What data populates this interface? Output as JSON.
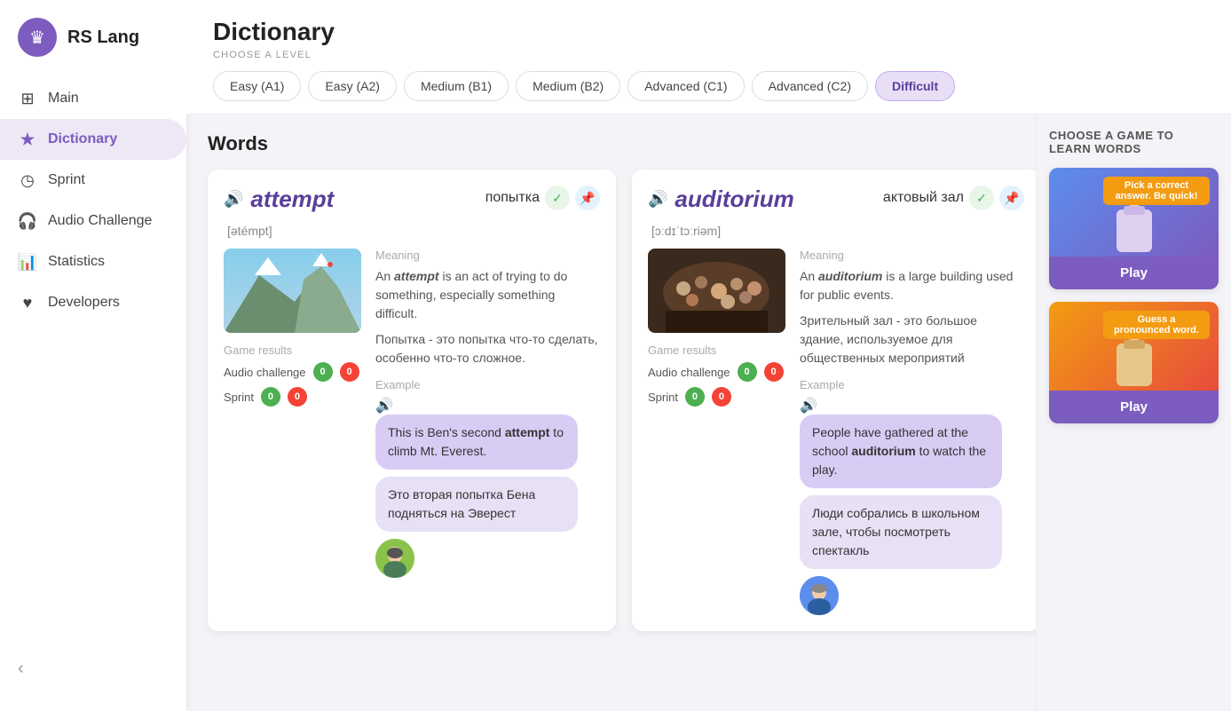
{
  "app": {
    "name": "RS Lang",
    "logo_symbol": "♛"
  },
  "sidebar": {
    "items": [
      {
        "id": "main",
        "label": "Main",
        "icon": "⊞"
      },
      {
        "id": "dictionary",
        "label": "Dictionary",
        "icon": "★",
        "active": true
      },
      {
        "id": "sprint",
        "label": "Sprint",
        "icon": "◷"
      },
      {
        "id": "audio-challenge",
        "label": "Audio Challenge",
        "icon": "🎧"
      },
      {
        "id": "statistics",
        "label": "Statistics",
        "icon": "📊"
      },
      {
        "id": "developers",
        "label": "Developers",
        "icon": "♥"
      }
    ],
    "collapse_label": "‹"
  },
  "header": {
    "title": "Dictionary",
    "level_label": "CHOOSE A LEVEL",
    "levels": [
      {
        "id": "a1",
        "label": "Easy (A1)"
      },
      {
        "id": "a2",
        "label": "Easy (A2)"
      },
      {
        "id": "b1",
        "label": "Medium (B1)"
      },
      {
        "id": "b2",
        "label": "Medium (B2)"
      },
      {
        "id": "c1",
        "label": "Advanced (C1)"
      },
      {
        "id": "c2",
        "label": "Advanced (C2)"
      },
      {
        "id": "difficult",
        "label": "Difficult",
        "active": true
      }
    ]
  },
  "words_section": {
    "title": "Words",
    "cards": [
      {
        "id": "attempt",
        "word": "attempt",
        "transcription": "[ətémpt]",
        "translation": "попытка",
        "meaning_en": "An attempt is an act of trying to do something, especially something difficult.",
        "meaning_ru": "Попытка - это попытка что-то сделать, особенно что-то сложное.",
        "example_en": "This is Ben's second attempt to climb Mt. Everest.",
        "example_ru": "Это вторая попытка Бена подняться на Эверест",
        "game_results_label": "Game results",
        "audio_challenge_label": "Audio challenge",
        "sprint_label": "Sprint",
        "audio_correct": 0,
        "audio_wrong": 0,
        "sprint_correct": 0,
        "sprint_wrong": 0
      },
      {
        "id": "auditorium",
        "word": "auditorium",
        "transcription": "[ɔːdɪˈtɔːriəm]",
        "translation": "актовый зал",
        "meaning_en": "An auditorium is a large building used for public events.",
        "meaning_ru": "Зрительный зал - это большое здание, используемое для общественных мероприятий",
        "example_en": "People have gathered at the school auditorium to watch the play.",
        "example_ru": "Люди собрались в школьном зале, чтобы посмотреть спектакль",
        "game_results_label": "Game results",
        "audio_challenge_label": "Audio challenge",
        "sprint_label": "Sprint",
        "audio_correct": 0,
        "audio_wrong": 0,
        "sprint_correct": 0,
        "sprint_wrong": 0
      }
    ]
  },
  "right_panel": {
    "title": "CHOOSE A GAME TO LEARN WORDS",
    "games": [
      {
        "id": "sprint",
        "tooltip": "Pick a correct answer. Be quick!",
        "play_label": "Play"
      },
      {
        "id": "audio-challenge",
        "tooltip": "Guess a pronounced word.",
        "play_label": "Play"
      }
    ]
  }
}
